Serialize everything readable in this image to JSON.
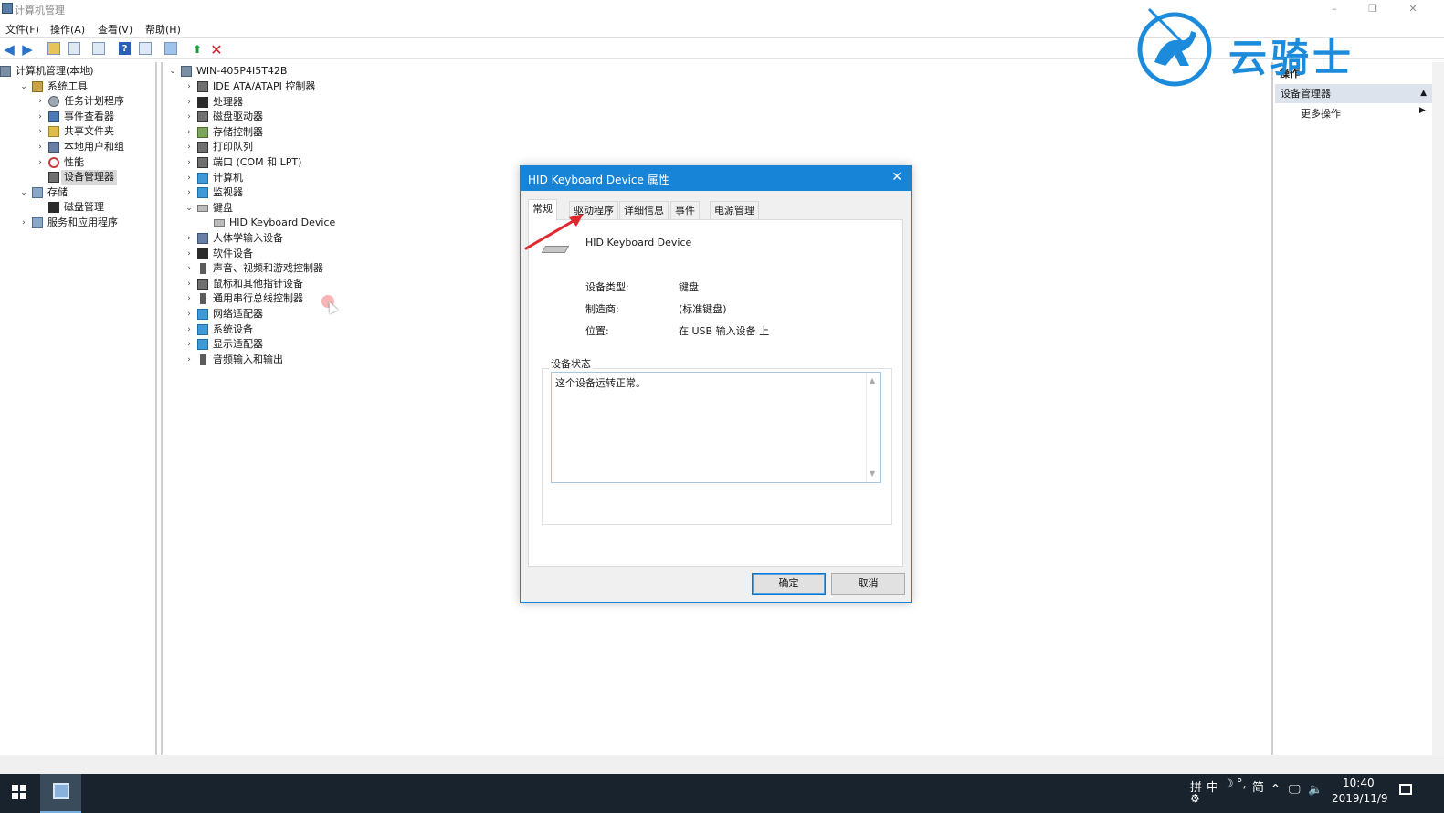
{
  "window": {
    "title": "计算机管理",
    "controls": {
      "minimize": "–",
      "restore": "❐",
      "close": "✕"
    }
  },
  "menu": [
    "文件(F)",
    "操作(A)",
    "查看(V)",
    "帮助(H)"
  ],
  "left_tree": [
    {
      "label": "计算机管理(本地)",
      "icon": "computer-management-icon",
      "depth": 0,
      "chev": ""
    },
    {
      "label": "系统工具",
      "icon": "system-tools-icon",
      "depth": 1,
      "chev": "⌄"
    },
    {
      "label": "任务计划程序",
      "icon": "task-scheduler-icon",
      "depth": 2,
      "chev": "›"
    },
    {
      "label": "事件查看器",
      "icon": "event-viewer-icon",
      "depth": 2,
      "chev": "›"
    },
    {
      "label": "共享文件夹",
      "icon": "shared-folders-icon",
      "depth": 2,
      "chev": "›"
    },
    {
      "label": "本地用户和组",
      "icon": "local-users-icon",
      "depth": 2,
      "chev": "›"
    },
    {
      "label": "性能",
      "icon": "performance-icon",
      "depth": 2,
      "chev": "›"
    },
    {
      "label": "设备管理器",
      "icon": "device-manager-icon",
      "depth": 2,
      "chev": "",
      "selected": true
    },
    {
      "label": "存储",
      "icon": "storage-icon",
      "depth": 1,
      "chev": "⌄"
    },
    {
      "label": "磁盘管理",
      "icon": "disk-management-icon",
      "depth": 2,
      "chev": ""
    },
    {
      "label": "服务和应用程序",
      "icon": "services-apps-icon",
      "depth": 1,
      "chev": "›"
    }
  ],
  "device_tree": {
    "root": "WIN-405P4I5T42B",
    "items": [
      {
        "label": "IDE ATA/ATAPI 控制器",
        "icon": "ide-controller-icon",
        "chev": "›"
      },
      {
        "label": "处理器",
        "icon": "processor-icon",
        "chev": "›"
      },
      {
        "label": "磁盘驱动器",
        "icon": "disk-drive-icon",
        "chev": "›"
      },
      {
        "label": "存储控制器",
        "icon": "storage-controller-icon",
        "chev": "›"
      },
      {
        "label": "打印队列",
        "icon": "print-queue-icon",
        "chev": "›"
      },
      {
        "label": "端口 (COM 和 LPT)",
        "icon": "port-icon",
        "chev": "›"
      },
      {
        "label": "计算机",
        "icon": "computer-icon",
        "chev": "›"
      },
      {
        "label": "监视器",
        "icon": "monitor-icon",
        "chev": "›"
      },
      {
        "label": "键盘",
        "icon": "keyboard-icon",
        "chev": "⌄"
      },
      {
        "label": "HID Keyboard Device",
        "icon": "keyboard-device-icon",
        "chev": "",
        "child": true
      },
      {
        "label": "人体学输入设备",
        "icon": "hid-icon",
        "chev": "›"
      },
      {
        "label": "软件设备",
        "icon": "software-device-icon",
        "chev": "›"
      },
      {
        "label": "声音、视频和游戏控制器",
        "icon": "sound-icon",
        "chev": "›"
      },
      {
        "label": "鼠标和其他指针设备",
        "icon": "mouse-icon",
        "chev": "›"
      },
      {
        "label": "通用串行总线控制器",
        "icon": "usb-icon",
        "chev": "›"
      },
      {
        "label": "网络适配器",
        "icon": "network-adapter-icon",
        "chev": "›"
      },
      {
        "label": "系统设备",
        "icon": "system-device-icon",
        "chev": "›"
      },
      {
        "label": "显示适配器",
        "icon": "display-adapter-icon",
        "chev": "›"
      },
      {
        "label": "音频输入和输出",
        "icon": "audio-io-icon",
        "chev": "›"
      }
    ]
  },
  "actions": {
    "header": "操作",
    "section": "设备管理器",
    "more": "更多操作"
  },
  "dialog": {
    "title": "HID Keyboard Device 属性",
    "close": "✕",
    "tabs": [
      "常规",
      "驱动程序",
      "详细信息",
      "事件",
      "电源管理"
    ],
    "active_tab": "常规",
    "device_name": "HID Keyboard Device",
    "props": [
      {
        "label": "设备类型:",
        "value": "键盘"
      },
      {
        "label": "制造商:",
        "value": "(标准键盘)"
      },
      {
        "label": "位置:",
        "value": "在 USB 输入设备 上"
      }
    ],
    "status_label": "设备状态",
    "status_text": "这个设备运转正常。",
    "ok": "确定",
    "cancel": "取消"
  },
  "watermark": {
    "text": "云骑士"
  },
  "taskbar": {
    "ime": [
      "拼",
      "中",
      "☽",
      "°,",
      "简"
    ],
    "time": "10:40",
    "date": "2019/11/9"
  },
  "colors": {
    "dialog_title": "#1884d7",
    "selected_bg": "#d9d9d9",
    "taskbar": "#19232d",
    "watermark": "#1c8bdc",
    "annotation_arrow": "#e0282e"
  }
}
